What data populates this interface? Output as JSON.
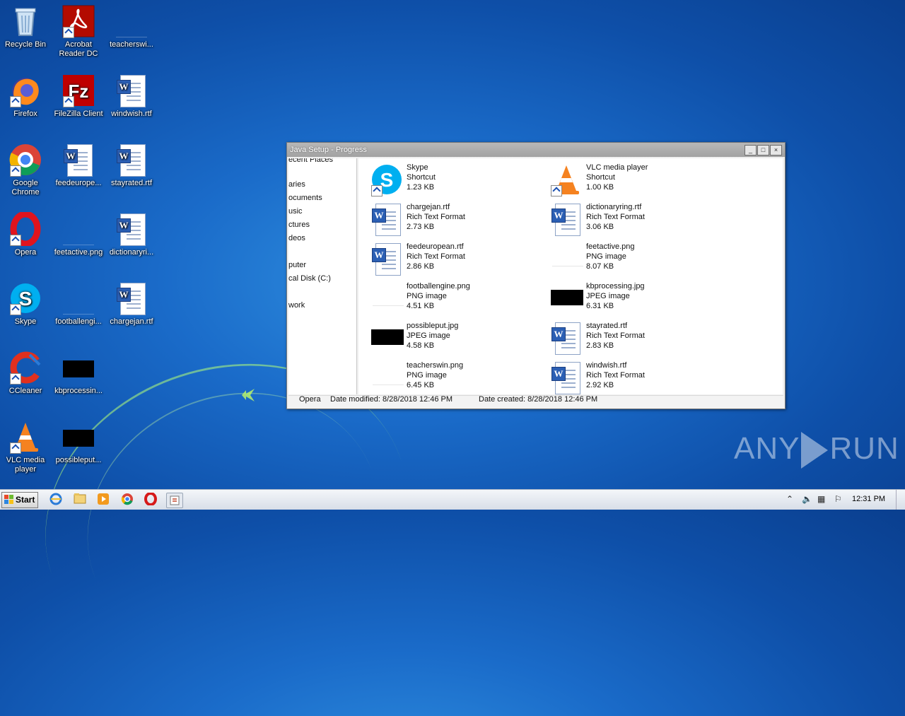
{
  "desktop_icons": [
    {
      "label": "Recycle Bin",
      "icon": "recycle-bin-icon"
    },
    {
      "label": "Acrobat Reader DC",
      "icon": "acrobat-icon"
    },
    {
      "label": "teacherswi...",
      "icon": "png-thumbnail-icon"
    },
    {
      "label": "Firefox",
      "icon": "firefox-icon"
    },
    {
      "label": "FileZilla Client",
      "icon": "filezilla-icon"
    },
    {
      "label": "windwish.rtf",
      "icon": "word-doc-icon"
    },
    {
      "label": "Google Chrome",
      "icon": "chrome-icon"
    },
    {
      "label": "feedeurope...",
      "icon": "word-doc-icon"
    },
    {
      "label": "stayrated.rtf",
      "icon": "word-doc-icon"
    },
    {
      "label": "Opera",
      "icon": "opera-icon"
    },
    {
      "label": "feetactive.png",
      "icon": "png-thumbnail-icon"
    },
    {
      "label": "dictionaryri...",
      "icon": "word-doc-icon"
    },
    {
      "label": "Skype",
      "icon": "skype-icon"
    },
    {
      "label": "footballengi...",
      "icon": "png-thumbnail-icon"
    },
    {
      "label": "chargejan.rtf",
      "icon": "word-doc-icon"
    },
    {
      "label": "CCleaner",
      "icon": "ccleaner-icon"
    },
    {
      "label": "kbprocessin...",
      "icon": "jpg-thumbnail-icon"
    },
    {
      "label": "VLC media player",
      "icon": "vlc-icon"
    },
    {
      "label": "possibleput...",
      "icon": "jpg-thumbnail-icon"
    }
  ],
  "window": {
    "title": "Java Setup - Progress",
    "controls": [
      "_",
      "□",
      "×"
    ],
    "nav_items": [
      "ecent Places",
      "aries",
      "ocuments",
      "usic",
      "ctures",
      "deos",
      "puter",
      "cal Disk (C:)",
      "work"
    ],
    "files": [
      {
        "name": "Skype",
        "type": "Shortcut",
        "size": "1.23 KB",
        "icon": "skype-icon"
      },
      {
        "name": "VLC media player",
        "type": "Shortcut",
        "size": "1.00 KB",
        "icon": "vlc-icon"
      },
      {
        "name": "chargejan.rtf",
        "type": "Rich Text Format",
        "size": "2.73 KB",
        "icon": "word-doc-icon"
      },
      {
        "name": "dictionaryring.rtf",
        "type": "Rich Text Format",
        "size": "3.06 KB",
        "icon": "word-doc-icon"
      },
      {
        "name": "feedeuropean.rtf",
        "type": "Rich Text Format",
        "size": "2.86 KB",
        "icon": "word-doc-icon"
      },
      {
        "name": "feetactive.png",
        "type": "PNG image",
        "size": "8.07 KB",
        "icon": "png-thumbnail-icon"
      },
      {
        "name": "footballengine.png",
        "type": "PNG image",
        "size": "4.51 KB",
        "icon": "png-thumbnail-icon"
      },
      {
        "name": "kbprocessing.jpg",
        "type": "JPEG image",
        "size": "6.31 KB",
        "icon": "jpg-thumbnail-icon"
      },
      {
        "name": "possibleput.jpg",
        "type": "JPEG image",
        "size": "4.58 KB",
        "icon": "jpg-thumbnail-icon"
      },
      {
        "name": "stayrated.rtf",
        "type": "Rich Text Format",
        "size": "2.83 KB",
        "icon": "word-doc-icon"
      },
      {
        "name": "teacherswin.png",
        "type": "PNG image",
        "size": "6.45 KB",
        "icon": "png-thumbnail-icon"
      },
      {
        "name": "windwish.rtf",
        "type": "Rich Text Format",
        "size": "2.92 KB",
        "icon": "word-doc-icon"
      }
    ],
    "status": {
      "name": "Opera",
      "modified": "Date modified: 8/28/2018 12:46 PM",
      "created": "Date created: 8/28/2018 12:46 PM"
    }
  },
  "taskbar": {
    "start_label": "Start",
    "pinned": [
      "ie-icon",
      "explorer-icon",
      "media-player-icon",
      "chrome-icon",
      "opera-icon",
      "java-setup-icon"
    ],
    "tray_icons": [
      "chevron-up-icon",
      "speaker-icon",
      "network-icon",
      "flag-icon"
    ],
    "clock": "12:31 PM"
  },
  "watermark": {
    "left": "ANY",
    "right": "RUN"
  }
}
